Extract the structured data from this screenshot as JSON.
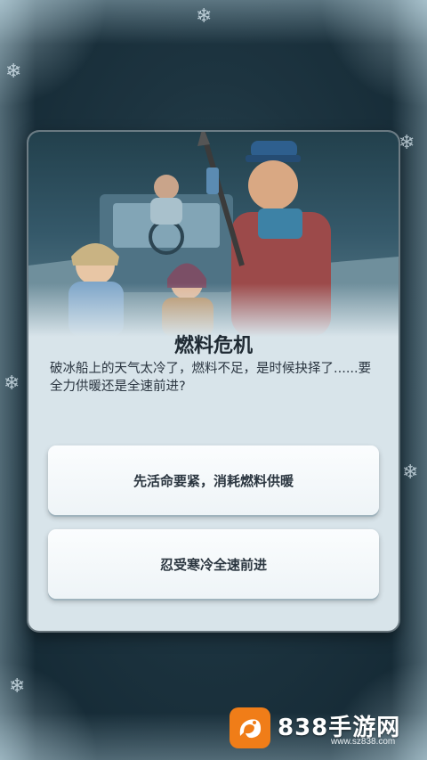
{
  "event": {
    "title": "燃料危机",
    "description": "破冰船上的天气太冷了，燃料不足，是时候抉择了......要全力供暖还是全速前进?"
  },
  "choices": [
    {
      "label": "先活命要紧，消耗燃料供暖"
    },
    {
      "label": "忍受寒冷全速前进"
    }
  ],
  "watermark": {
    "brand": "838手游网",
    "url": "www.sz838.com"
  },
  "colors": {
    "accent": "#f07d18",
    "card": "#d8e4ea",
    "background": "#1d3440"
  }
}
